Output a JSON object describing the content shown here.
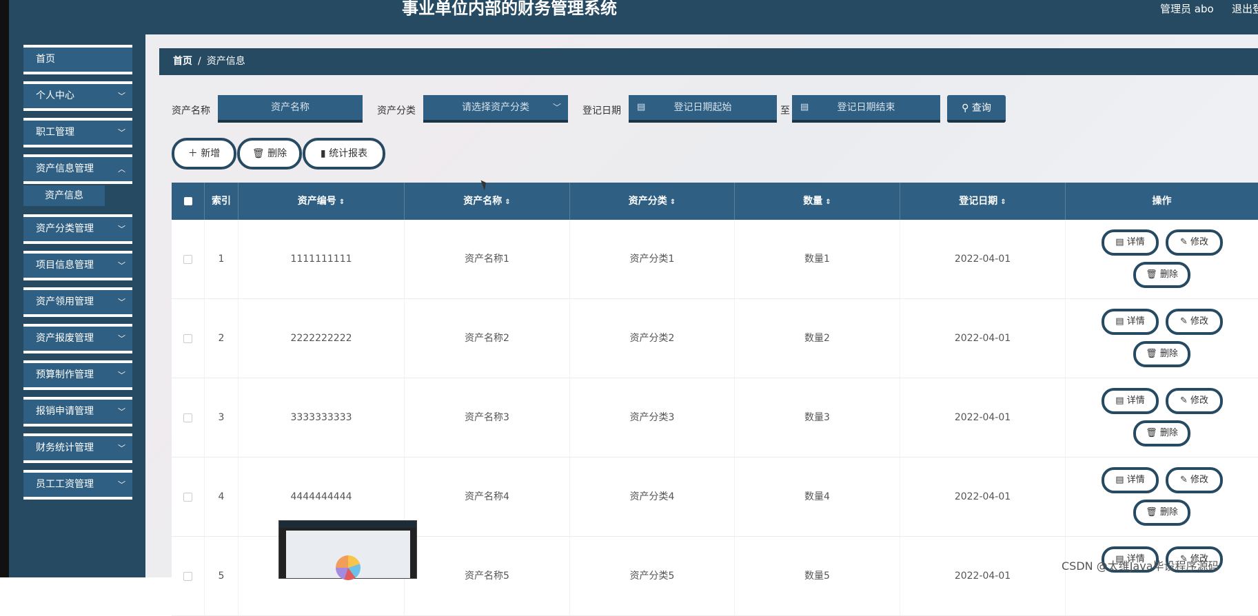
{
  "app": {
    "title": "事业单位内部的财务管理系统",
    "user": "管理员 abo",
    "logout": "退出登"
  },
  "sidebar": {
    "items": [
      {
        "label": "首页",
        "chevron": false
      },
      {
        "label": "个人中心",
        "chevron": true
      },
      {
        "label": "职工管理",
        "chevron": true
      },
      {
        "label": "资产信息管理",
        "chevron": true
      },
      {
        "label": "资产分类管理",
        "chevron": true
      },
      {
        "label": "项目信息管理",
        "chevron": true
      },
      {
        "label": "资产领用管理",
        "chevron": true
      },
      {
        "label": "资产报废管理",
        "chevron": true
      },
      {
        "label": "预算制作管理",
        "chevron": true
      },
      {
        "label": "报销申请管理",
        "chevron": true
      },
      {
        "label": "财务统计管理",
        "chevron": true
      },
      {
        "label": "员工工资管理",
        "chevron": true
      }
    ],
    "active_sub": "资产信息"
  },
  "breadcrumb": {
    "home": "首页",
    "sep": "/",
    "current": "资产信息"
  },
  "search": {
    "name_label": "资产名称",
    "name_placeholder": "资产名称",
    "category_label": "资产分类",
    "category_placeholder": "请选择资产分类",
    "date_label": "登记日期",
    "date_start_placeholder": "登记日期起始",
    "date_to": "至",
    "date_end_placeholder": "登记日期结束",
    "query_label": "查询"
  },
  "actions": {
    "add": "新增",
    "delete": "删除",
    "report": "统计报表"
  },
  "table": {
    "headers": {
      "index": "索引",
      "code": "资产编号",
      "name": "资产名称",
      "category": "资产分类",
      "qty": "数量",
      "date": "登记日期",
      "ops": "操作"
    },
    "rows": [
      {
        "index": "1",
        "code": "1111111111",
        "name": "资产名称1",
        "category": "资产分类1",
        "qty": "数量1",
        "date": "2022-04-01"
      },
      {
        "index": "2",
        "code": "2222222222",
        "name": "资产名称2",
        "category": "资产分类2",
        "qty": "数量2",
        "date": "2022-04-01"
      },
      {
        "index": "3",
        "code": "3333333333",
        "name": "资产名称3",
        "category": "资产分类3",
        "qty": "数量3",
        "date": "2022-04-01"
      },
      {
        "index": "4",
        "code": "4444444444",
        "name": "资产名称4",
        "category": "资产分类4",
        "qty": "数量4",
        "date": "2022-04-01"
      },
      {
        "index": "5",
        "code": "",
        "name": "资产名称5",
        "category": "资产分类5",
        "qty": "数量5",
        "date": "2022-04-01"
      }
    ],
    "row_actions": {
      "detail": "详情",
      "edit": "修改",
      "delete": "删除"
    }
  },
  "watermark": "CSDN @太维Java毕设程序源码",
  "colors": {
    "primary": "#264a62",
    "button": "#2f5f82"
  }
}
